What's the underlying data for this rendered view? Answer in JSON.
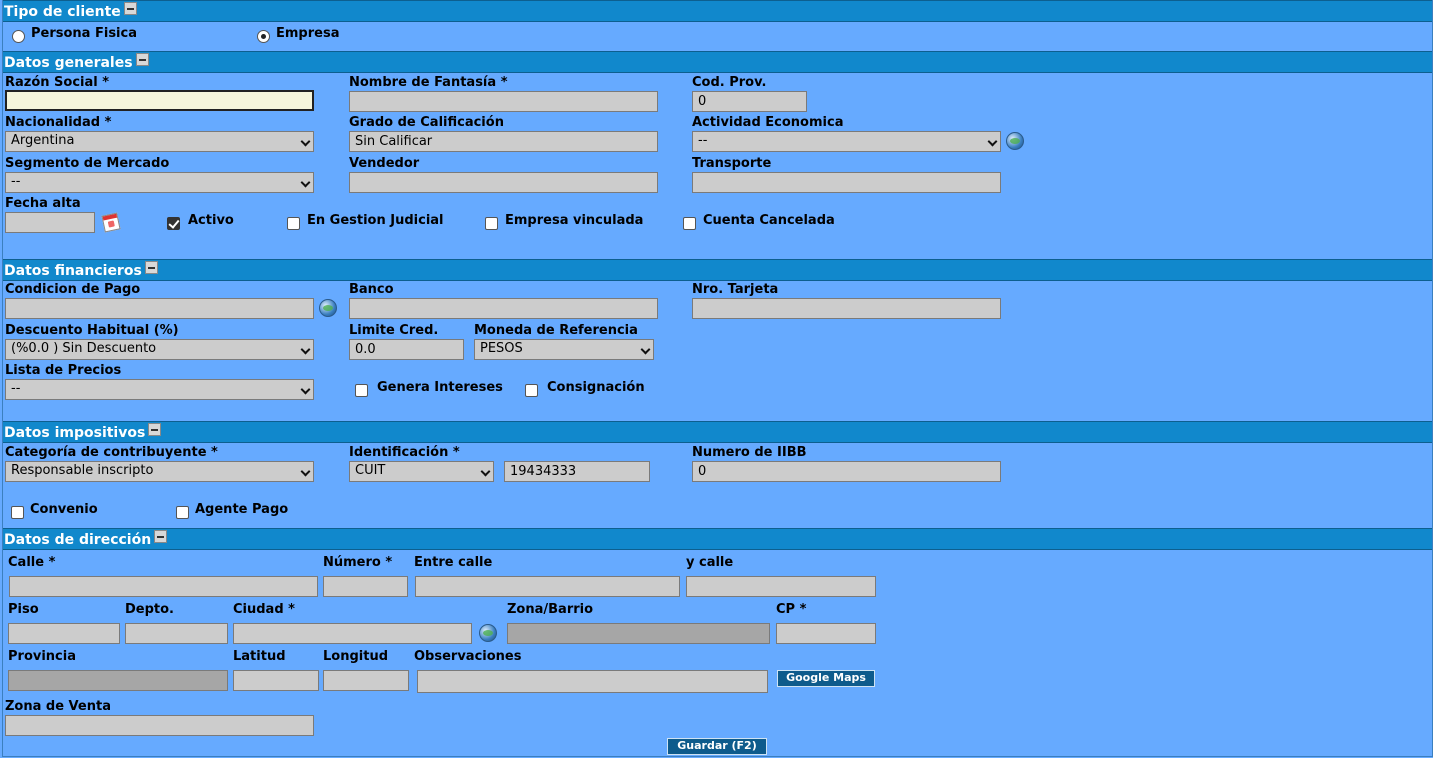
{
  "sections": {
    "tipo_cliente": "Tipo de cliente",
    "datos_generales": "Datos generales",
    "datos_financieros": "Datos financieros",
    "datos_impositivos": "Datos impositivos",
    "datos_direccion": "Datos de dirección"
  },
  "tipo_cliente": {
    "persona_fisica": {
      "label": "Persona Fisica",
      "selected": false
    },
    "empresa": {
      "label": "Empresa",
      "selected": true
    }
  },
  "generales": {
    "razon_social": {
      "label": "Razón Social *",
      "value": ""
    },
    "nombre_fantasia": {
      "label": "Nombre de Fantasía *",
      "value": ""
    },
    "cod_prov": {
      "label": "Cod. Prov.",
      "value": "0"
    },
    "nacionalidad": {
      "label": "Nacionalidad *",
      "value": "Argentina"
    },
    "grado_calificacion": {
      "label": "Grado de Calificación",
      "value": "Sin Calificar"
    },
    "actividad_economica": {
      "label": "Actividad Economica",
      "value": "--"
    },
    "segmento_mercado": {
      "label": "Segmento de Mercado",
      "value": "--"
    },
    "vendedor": {
      "label": "Vendedor",
      "value": ""
    },
    "transporte": {
      "label": "Transporte",
      "value": ""
    },
    "fecha_alta": {
      "label": "Fecha alta",
      "value": ""
    },
    "activo": {
      "label": "Activo",
      "checked": true
    },
    "gestion_judicial": {
      "label": "En Gestion Judicial",
      "checked": false
    },
    "empresa_vinculada": {
      "label": "Empresa vinculada",
      "checked": false
    },
    "cuenta_cancelada": {
      "label": "Cuenta Cancelada",
      "checked": false
    }
  },
  "financieros": {
    "condicion_pago": {
      "label": "Condicion de Pago",
      "value": ""
    },
    "banco": {
      "label": "Banco",
      "value": ""
    },
    "nro_tarjeta": {
      "label": "Nro. Tarjeta",
      "value": ""
    },
    "descuento_habitual": {
      "label": "Descuento Habitual (%)",
      "value": "(%0.0 ) Sin Descuento"
    },
    "limite_cred": {
      "label": "Limite Cred.",
      "value": "0.0"
    },
    "moneda_referencia": {
      "label": "Moneda de Referencia",
      "value": "PESOS"
    },
    "lista_precios": {
      "label": "Lista de Precios",
      "value": "--"
    },
    "genera_intereses": {
      "label": "Genera Intereses",
      "checked": false
    },
    "consignacion": {
      "label": "Consignación",
      "checked": false
    }
  },
  "impositivos": {
    "categoria_contribuyente": {
      "label": "Categoría de contribuyente *",
      "value": "Responsable inscripto"
    },
    "identificacion": {
      "label": "Identificación *",
      "type": "CUIT",
      "value": "19434333"
    },
    "numero_iibb": {
      "label": "Numero de IIBB",
      "value": "0"
    },
    "convenio": {
      "label": "Convenio",
      "checked": false
    },
    "agente_pago": {
      "label": "Agente Pago",
      "checked": false
    }
  },
  "direccion": {
    "calle": {
      "label": "Calle *",
      "value": ""
    },
    "numero": {
      "label": "Número *",
      "value": ""
    },
    "entre_calle": {
      "label": "Entre calle",
      "value": ""
    },
    "y_calle": {
      "label": "y calle",
      "value": ""
    },
    "piso": {
      "label": "Piso",
      "value": ""
    },
    "depto": {
      "label": "Depto.",
      "value": ""
    },
    "ciudad": {
      "label": "Ciudad *",
      "value": ""
    },
    "zona_barrio": {
      "label": "Zona/Barrio",
      "value": ""
    },
    "cp": {
      "label": "CP *",
      "value": ""
    },
    "provincia": {
      "label": "Provincia",
      "value": ""
    },
    "latitud": {
      "label": "Latitud",
      "value": ""
    },
    "longitud": {
      "label": "Longitud",
      "value": ""
    },
    "observaciones": {
      "label": "Observaciones",
      "value": ""
    },
    "google_maps": "Google Maps",
    "zona_venta": {
      "label": "Zona de Venta",
      "value": ""
    }
  },
  "guardar": "Guardar (F2)",
  "colors": {
    "background": "#66aaff",
    "section_bar": "#1188cc",
    "input": "#cccccc",
    "input_disabled": "#a6a6a6",
    "button": "#0e5b8c"
  }
}
